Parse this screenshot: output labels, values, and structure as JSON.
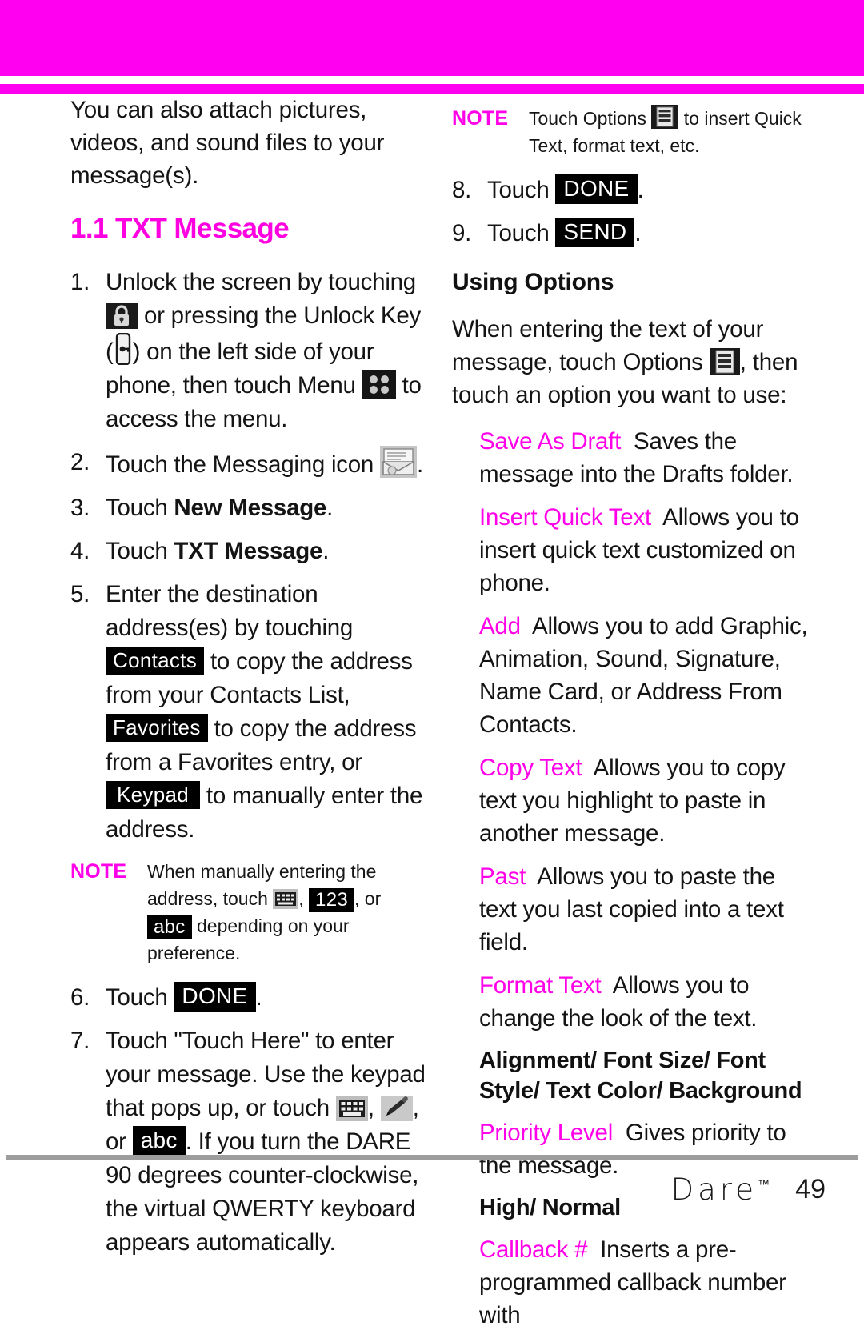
{
  "theme": {
    "accent": "#ff00f0",
    "note_label_color": "#ff00e8",
    "text_color": "#141414",
    "chip_bg": "#000000",
    "footer_rule": "#9d9d9d"
  },
  "left_column": {
    "intro_paragraph": "You can also attach pictures, videos, and sound files to your message(s).",
    "section_title": "1.1 TXT Message",
    "steps": [
      {
        "num": "1.",
        "parts": [
          {
            "type": "text",
            "value": "Unlock the screen by touching "
          },
          {
            "type": "icon",
            "value": "padlock-icon"
          },
          {
            "type": "text",
            "value": " or pressing the Unlock Key ("
          },
          {
            "type": "icon",
            "value": "unlock-key-icon"
          },
          {
            "type": "text",
            "value": ") on the left side of your phone, then touch Menu "
          },
          {
            "type": "icon",
            "value": "menu-grid-icon"
          },
          {
            "type": "text",
            "value": " to access the menu."
          }
        ]
      },
      {
        "num": "2.",
        "parts": [
          {
            "type": "text",
            "value": "Touch the Messaging icon "
          },
          {
            "type": "icon",
            "value": "messaging-envelope-icon"
          },
          {
            "type": "text",
            "value": "."
          }
        ]
      },
      {
        "num": "3.",
        "parts": [
          {
            "type": "text",
            "value": "Touch "
          },
          {
            "type": "bold",
            "value": "New Message"
          },
          {
            "type": "text",
            "value": "."
          }
        ]
      },
      {
        "num": "4.",
        "parts": [
          {
            "type": "text",
            "value": "Touch "
          },
          {
            "type": "bold",
            "value": "TXT Message"
          },
          {
            "type": "text",
            "value": "."
          }
        ]
      },
      {
        "num": "5.",
        "parts": [
          {
            "type": "text",
            "value": "Enter the destination address(es) by touching "
          },
          {
            "type": "chip",
            "value": "Contacts"
          },
          {
            "type": "text",
            "value": " to copy the address from your Contacts List, "
          },
          {
            "type": "chip",
            "value": "Favorites"
          },
          {
            "type": "text",
            "value": " to copy the address from a Favorites entry, or "
          },
          {
            "type": "chip",
            "value": "Keypad"
          },
          {
            "type": "text",
            "value": " to manually enter the address."
          }
        ]
      },
      {
        "num": "6.",
        "parts": [
          {
            "type": "text",
            "value": "Touch "
          },
          {
            "type": "chip",
            "value": "DONE"
          },
          {
            "type": "text",
            "value": "."
          }
        ]
      },
      {
        "num": "7.",
        "parts": [
          {
            "type": "text",
            "value": "Touch \"Touch Here\" to enter your message. Use the keypad that pops up, or touch "
          },
          {
            "type": "icon",
            "value": "keyboard-icon"
          },
          {
            "type": "text",
            "value": ", "
          },
          {
            "type": "icon",
            "value": "pencil-icon"
          },
          {
            "type": "text",
            "value": ", or "
          },
          {
            "type": "chip",
            "value": "abc"
          },
          {
            "type": "text",
            "value": ". If you turn the DARE 90 degrees counter-clockwise, the virtual QWERTY keyboard appears automatically."
          }
        ]
      }
    ],
    "note": {
      "label": "NOTE",
      "parts": [
        {
          "type": "text",
          "value": "When manually entering the address, touch "
        },
        {
          "type": "icon",
          "value": "keyboard-icon"
        },
        {
          "type": "text",
          "value": ", "
        },
        {
          "type": "chip",
          "value": "123"
        },
        {
          "type": "text",
          "value": ", or "
        },
        {
          "type": "chip",
          "value": "abc"
        },
        {
          "type": "text",
          "value": " depending on your preference."
        }
      ]
    }
  },
  "right_column": {
    "note": {
      "label": "NOTE",
      "parts": [
        {
          "type": "text",
          "value": "Touch Options "
        },
        {
          "type": "icon",
          "value": "options-list-icon"
        },
        {
          "type": "text",
          "value": " to insert Quick Text, format text, etc."
        }
      ]
    },
    "steps": [
      {
        "num": "8.",
        "parts": [
          {
            "type": "text",
            "value": "Touch "
          },
          {
            "type": "chip",
            "value": "DONE"
          },
          {
            "type": "text",
            "value": "."
          }
        ]
      },
      {
        "num": "9.",
        "parts": [
          {
            "type": "text",
            "value": "Touch "
          },
          {
            "type": "chip",
            "value": "SEND"
          },
          {
            "type": "text",
            "value": "."
          }
        ]
      }
    ],
    "sub_title": "Using Options",
    "intro_parts": [
      {
        "type": "text",
        "value": "When entering the text of your message, touch Options "
      },
      {
        "type": "icon",
        "value": "options-list-icon"
      },
      {
        "type": "text",
        "value": ", then touch an option you want to use:"
      }
    ],
    "options": [
      {
        "term": "Save As Draft",
        "description": "Saves the message into the Drafts folder."
      },
      {
        "term": "Insert Quick Text",
        "description": "Allows you to insert quick text customized on phone."
      },
      {
        "term": "Add",
        "description": "Allows you to add Graphic, Animation, Sound, Signature, Name Card, or Address From Contacts."
      },
      {
        "term": "Copy Text",
        "description": "Allows you to copy text you highlight to paste in another message."
      },
      {
        "term": "Past",
        "description": "Allows you to paste the text you last copied into a text field."
      },
      {
        "term": "Format Text",
        "description": "Allows you to change the look of the text.",
        "values": "Alignment/ Font Size/ Font Style/ Text Color/ Background"
      },
      {
        "term": "Priority Level",
        "description": "Gives priority to the message.",
        "values": "High/ Normal"
      },
      {
        "term": "Callback #",
        "description": "Inserts a pre-programmed callback number with"
      }
    ]
  },
  "footer": {
    "brand": "Dare",
    "trademark": "™",
    "page_number": "49"
  }
}
